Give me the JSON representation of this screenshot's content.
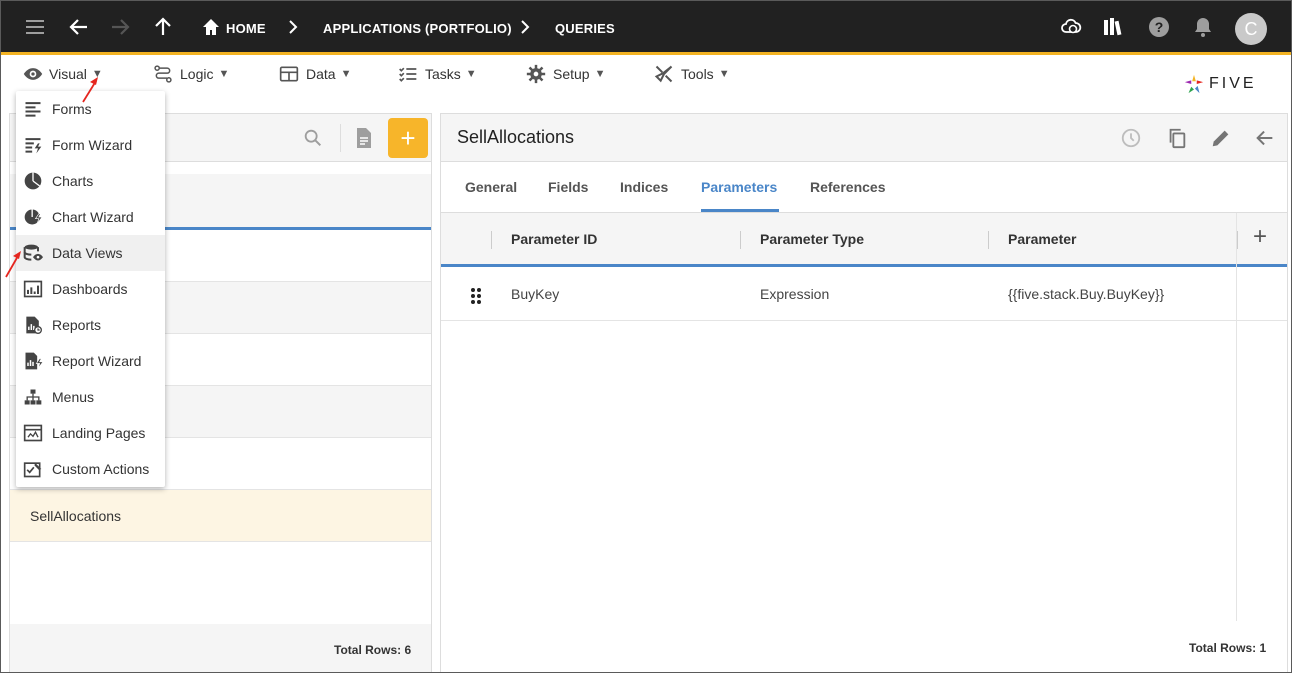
{
  "topbar": {
    "breadcrumb": {
      "home": "HOME",
      "applications": "APPLICATIONS (PORTFOLIO)",
      "queries": "QUERIES"
    },
    "avatar_letter": "C"
  },
  "menubar": {
    "items": [
      {
        "label": "Visual",
        "icon": "eye-icon"
      },
      {
        "label": "Logic",
        "icon": "logic-icon"
      },
      {
        "label": "Data",
        "icon": "table-icon"
      },
      {
        "label": "Tasks",
        "icon": "tasks-icon"
      },
      {
        "label": "Setup",
        "icon": "gear-icon"
      },
      {
        "label": "Tools",
        "icon": "tools-icon"
      }
    ],
    "caret": "▼"
  },
  "logo": {
    "text": "FIVE"
  },
  "visual_menu": {
    "items": [
      {
        "label": "Forms",
        "icon": "forms-icon"
      },
      {
        "label": "Form Wizard",
        "icon": "form-wizard-icon"
      },
      {
        "label": "Charts",
        "icon": "charts-icon"
      },
      {
        "label": "Chart Wizard",
        "icon": "chart-wizard-icon"
      },
      {
        "label": "Data Views",
        "icon": "data-views-icon"
      },
      {
        "label": "Dashboards",
        "icon": "dashboards-icon"
      },
      {
        "label": "Reports",
        "icon": "reports-icon"
      },
      {
        "label": "Report Wizard",
        "icon": "report-wizard-icon"
      },
      {
        "label": "Menus",
        "icon": "menus-icon"
      },
      {
        "label": "Landing Pages",
        "icon": "landing-pages-icon"
      },
      {
        "label": "Custom Actions",
        "icon": "custom-actions-icon"
      }
    ]
  },
  "left_panel": {
    "selected_row": "SellAllocations",
    "total_rows": "Total Rows: 6",
    "add_label": "+"
  },
  "right_panel": {
    "title": "SellAllocations",
    "tabs": [
      "General",
      "Fields",
      "Indices",
      "Parameters",
      "References"
    ],
    "active_tab": "Parameters",
    "columns": [
      "Parameter ID",
      "Parameter Type",
      "Parameter"
    ],
    "add_column_label": "+",
    "rows": [
      {
        "id": "BuyKey",
        "type": "Expression",
        "parameter": "{{five.stack.Buy.BuyKey}}"
      }
    ],
    "total_rows": "Total Rows: 1"
  },
  "colors": {
    "topbar_bg": "#212121",
    "accent_yellow": "#f7b52a",
    "accent_blue": "#4a86c8",
    "selected_row_bg": "#fdf5e3",
    "annotation_red": "#e5261f"
  }
}
